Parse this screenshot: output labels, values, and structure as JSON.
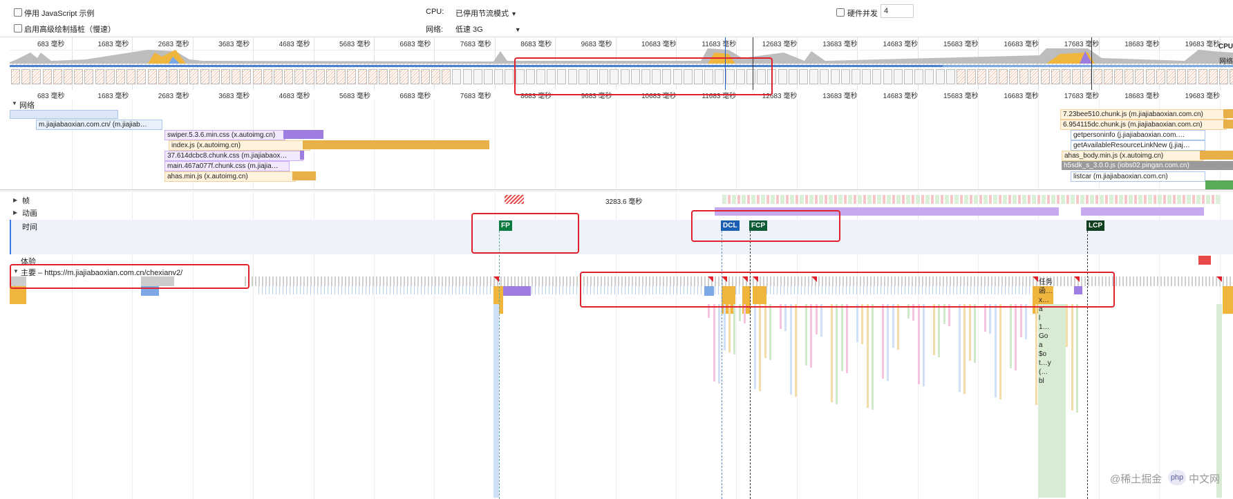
{
  "settings": {
    "disable_js_label": "停用 JavaScript 示例",
    "advanced_paint_label": "启用高级绘制插桩（慢速）",
    "cpu_label": "CPU:",
    "cpu_value": "已停用节流模式",
    "network_label": "网络:",
    "network_value": "低速 3G",
    "hw_concurrency_label": "硬件并发",
    "hw_concurrency_value": "4"
  },
  "overview": {
    "tick_labels": [
      "683 毫秒",
      "1683 毫秒",
      "2683 毫秒",
      "3683 毫秒",
      "4683 毫秒",
      "5683 毫秒",
      "6683 毫秒",
      "7683 毫秒",
      "8683 毫秒",
      "9683 毫秒",
      "10683 毫秒",
      "11683 毫秒",
      "12683 毫秒",
      "13683 毫秒",
      "14683 毫秒",
      "15683 毫秒",
      "16683 毫秒",
      "17683 毫秒",
      "18683 毫秒",
      "19683 毫秒"
    ],
    "cpu_label": "CPU",
    "net_label": "网络"
  },
  "tracks": {
    "network_label": "网络",
    "frames_label": "帧",
    "frames_value": "3283.6 毫秒",
    "animation_label": "动画",
    "timings_label": "时间",
    "experience_label": "体验",
    "main_label": "主要 – https://m.jiajiabaoxian.com.cn/chexianv2/"
  },
  "markers": {
    "fp": "FP",
    "dcl": "DCL",
    "fcp": "FCP",
    "lcp": "LCP"
  },
  "requests": {
    "doc": "m.jiajiabaoxian.com.cn/ (m.jiajiab…",
    "swiper": "swiper.5.3.6.min.css (x.autoimg.cn)",
    "index": "index.js (x.autoimg.cn)",
    "chunkcss1": "37.614dcbc8.chunk.css (m.jiajiabaox…",
    "chunkcss2": "main.467a077f.chunk.css (m.jiajia…",
    "ahas": "ahas.min.js (x.autoimg.cn)",
    "r7": "7.23bee510.chunk.js (m.jiajiabaoxian.com.cn)",
    "r6": "6.954115dc.chunk.js (m.jiajiabaoxian.com.cn)",
    "getperson": "getpersoninfo (j.jiajiabaoxian.com.…",
    "getavail": "getAvailableResourceLinkNew (j.jiaj…",
    "ahasbody": "ahas_body.min.js (x.autoimg.cn)",
    "h5sdk": "h5sdk_s_3.0.0.js (iobs02.pingan.com.cn)",
    "listcar": "listcar (m.jiajiabaoxian.com.cn)"
  },
  "flame_labels": [
    "任务",
    "函…",
    "x…",
    "a",
    "l",
    "1…",
    "Go",
    "a",
    "$o",
    "t…y",
    "(…",
    "bl"
  ],
  "watermark": "@稀土掘金",
  "colors": {
    "highlight": "#e0202a",
    "scripting": "#f0b53c",
    "rendering": "#9d7ee0",
    "painting": "#6ec06e",
    "loading": "#7da8e6"
  }
}
